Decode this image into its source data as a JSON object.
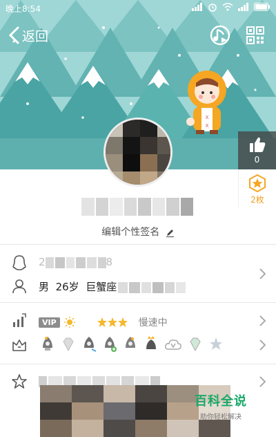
{
  "status_bar": {
    "time": "晚上8:54",
    "icons": [
      "alarm-icon",
      "wifi-icon",
      "signal-icon",
      "battery-icon"
    ]
  },
  "nav": {
    "back_label": "返回",
    "icons": [
      "chevron-left-icon",
      "music-icon",
      "qr-code-icon"
    ]
  },
  "profile": {
    "likes_count": "0",
    "badge_count": "2枚",
    "signature_label": "编辑个性签名"
  },
  "info": {
    "qq_prefix": "2",
    "qq_suffix": "8",
    "gender": "男",
    "age": "26岁",
    "zodiac": "巨蟹座"
  },
  "vip": {
    "tag": "VIP",
    "level_icons": [
      "sun",
      "moon",
      "moon",
      "star",
      "star",
      "star"
    ],
    "speed_status": "慢速中"
  },
  "achievement_badges": [
    "rocket-badge",
    "diamond-badge",
    "rocket-badge",
    "rocket-plus-badge",
    "rocket-badge",
    "crown-badge",
    "cloud-v-badge",
    "diamond-badge",
    "star-badge"
  ],
  "watermark": {
    "title": "百科全说",
    "subtitle": "助你轻松解决"
  },
  "colors": {
    "sky": "#9fd7d6",
    "tree": "#4aa4a4",
    "accent_orange": "#f5a623",
    "watermark_green": "#1aa86a"
  }
}
